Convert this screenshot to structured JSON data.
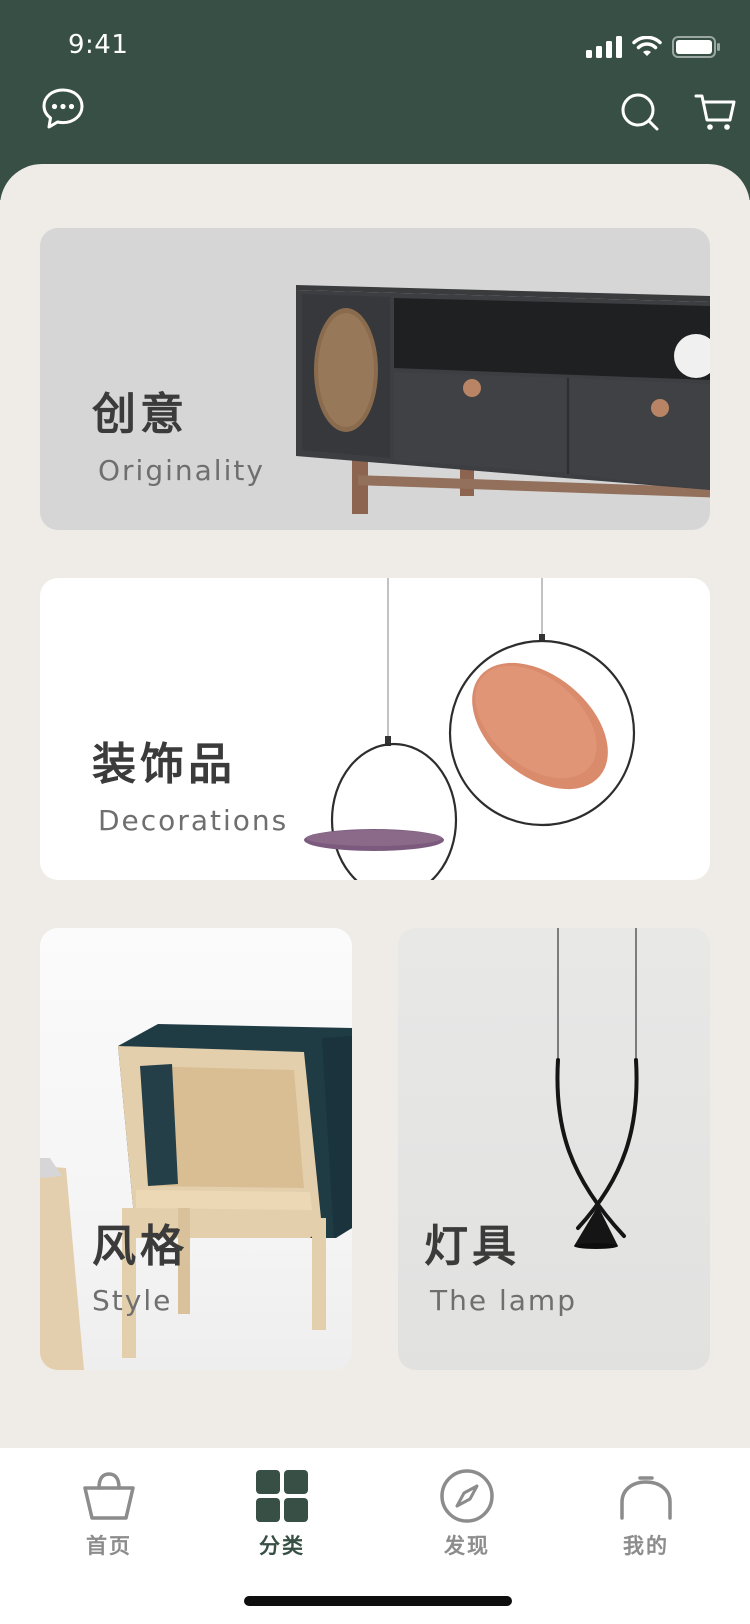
{
  "status_bar": {
    "time": "9:41",
    "icons": [
      "signal-icon",
      "wifi-icon",
      "battery-icon"
    ]
  },
  "header": {
    "left_icon": "chat-bubble-icon",
    "right_icons": [
      "search-icon",
      "cart-icon"
    ],
    "background_color": "#374f44"
  },
  "categories": [
    {
      "title_cn": "创意",
      "title_en": "Originality"
    },
    {
      "title_cn": "装饰品",
      "title_en": "Decorations"
    },
    {
      "title_cn": "风格",
      "title_en": "Style"
    },
    {
      "title_cn": "灯具",
      "title_en": "The lamp"
    }
  ],
  "tabbar": {
    "items": [
      {
        "label": "首页",
        "icon": "shopping-bag-icon",
        "active": false
      },
      {
        "label": "分类",
        "icon": "grid-icon",
        "active": true
      },
      {
        "label": "发现",
        "icon": "compass-icon",
        "active": false
      },
      {
        "label": "我的",
        "icon": "user-icon",
        "active": false
      }
    ],
    "active_color": "#374f44",
    "inactive_color": "#8c8c8c"
  }
}
